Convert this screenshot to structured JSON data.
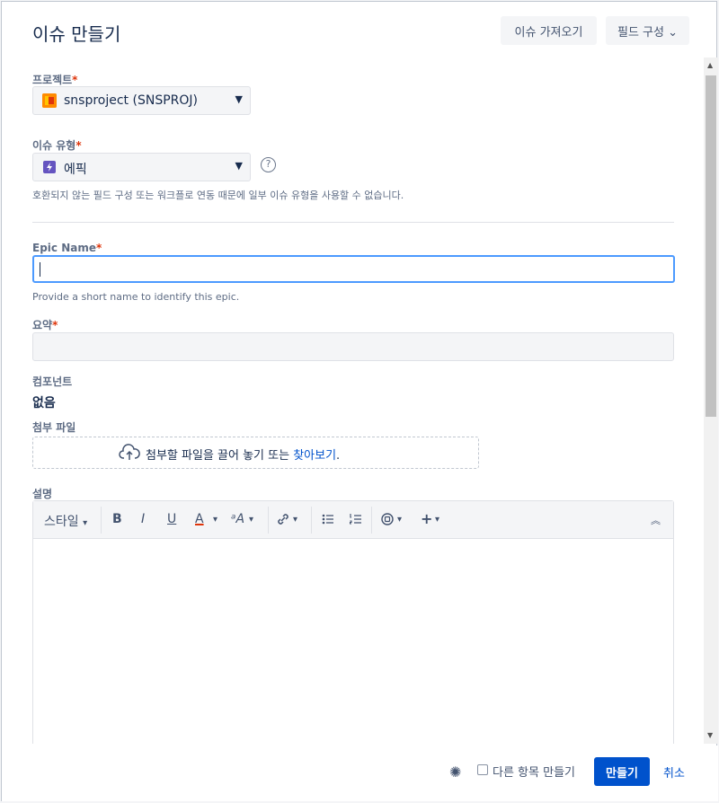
{
  "dialog": {
    "title": "이슈 만들기",
    "import_label": "이슈 가져오기",
    "configure_label": "필드 구성 ⌄"
  },
  "project": {
    "label": "프로젝트",
    "value": "snsproject (SNSPROJ)"
  },
  "issue_type": {
    "label": "이슈 유형",
    "value": "에픽",
    "hint": "호환되지 않는 필드 구성 또는 워크플로 연동 때문에 일부 이슈 유형을 사용할 수 없습니다."
  },
  "epic_name": {
    "label": "Epic Name",
    "value": "",
    "hint": "Provide a short name to identify this epic."
  },
  "summary": {
    "label": "요약",
    "value": ""
  },
  "components": {
    "label": "컴포넌트",
    "value": "없음"
  },
  "attachment": {
    "label": "첨부 파일",
    "drop_text": "첨부할 파일을 끌어 놓기 또는",
    "browse_link": "찾아보기",
    "period": "."
  },
  "description": {
    "label": "설명",
    "toolbar": {
      "style": "스타일",
      "bold": "B",
      "italic": "I",
      "underline": "U",
      "text_color": "A",
      "text_size": "ᵃA",
      "link": "🔗"
    }
  },
  "footer": {
    "create_another": "다른 항목 만들기",
    "create": "만들기",
    "cancel": "취소"
  },
  "colors": {
    "primary": "#0052cc",
    "required": "#de350b",
    "epic": "#6554c0",
    "focus": "#4c9aff"
  }
}
